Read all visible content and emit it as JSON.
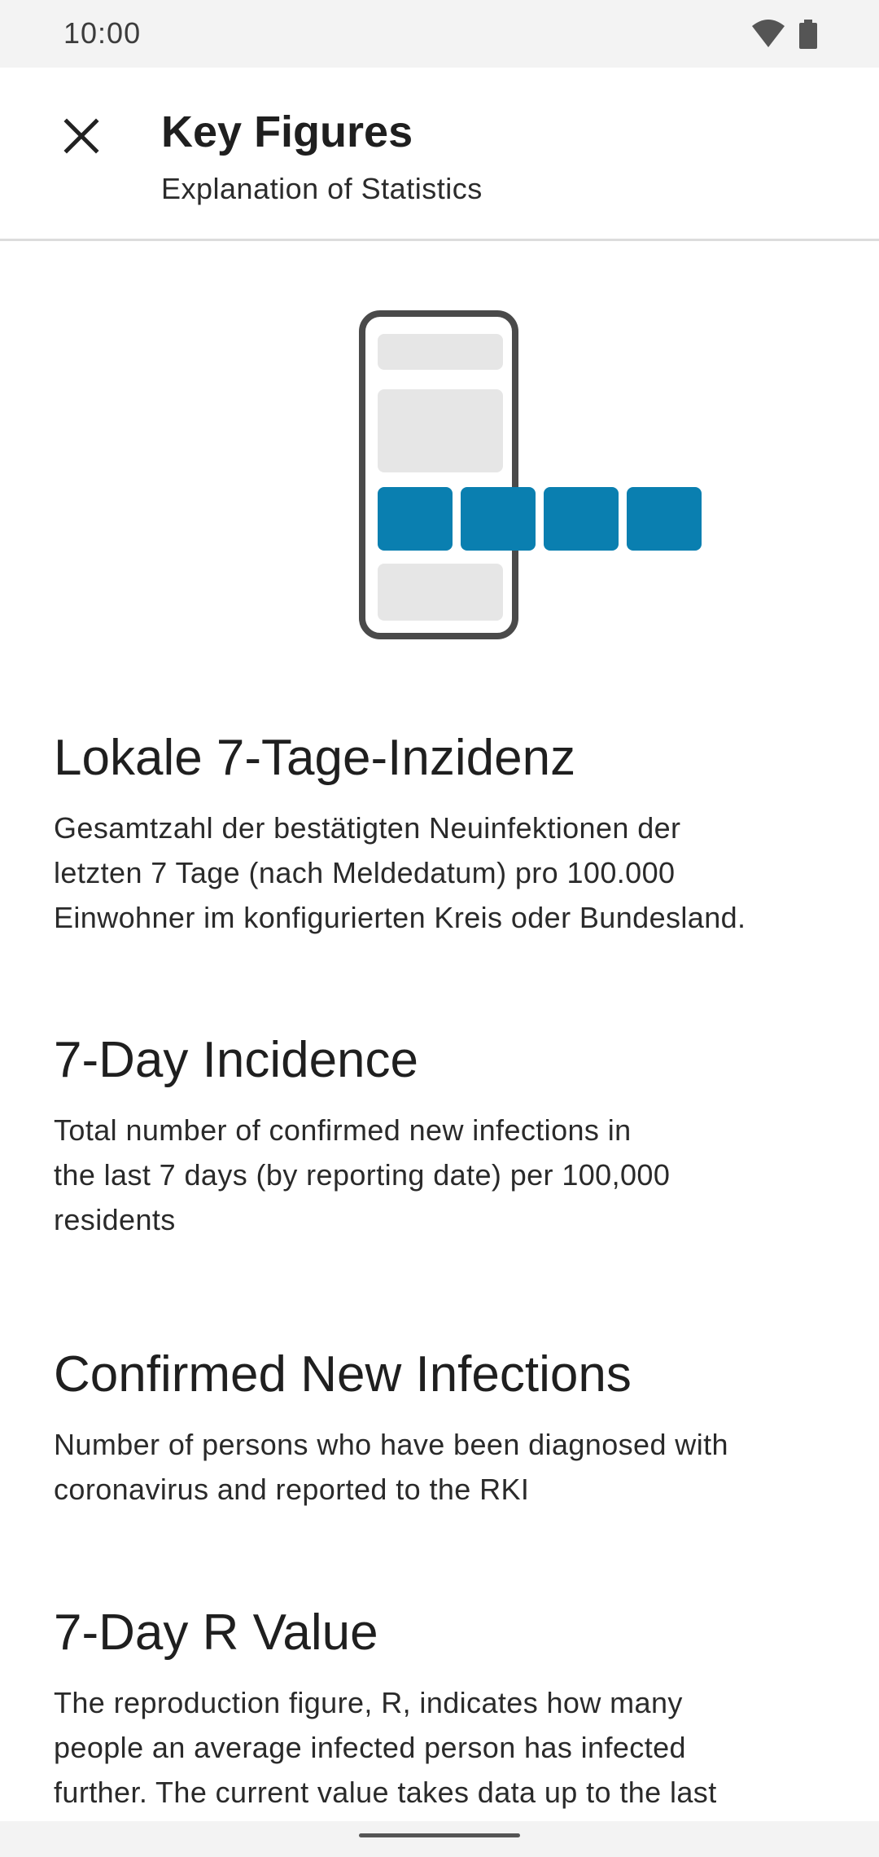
{
  "status_bar": {
    "time": "10:00",
    "icons": [
      "wifi-icon",
      "battery-icon"
    ]
  },
  "app_bar": {
    "close_icon": "close-icon",
    "title": "Key Figures",
    "subtitle": "Explanation of Statistics"
  },
  "illustration": {
    "icon": "phone-key-figures-illustration",
    "accent_color": "#0a7fb0",
    "frame_color": "#4a4a4a",
    "placeholder_color": "#e6e6e6"
  },
  "sections": [
    {
      "heading": "Lokale 7-Tage-Inzidenz",
      "lines": [
        "Gesamtzahl der bestätigten Neuinfektionen der",
        "letzten 7 Tage (nach Meldedatum) pro 100.000",
        "Einwohner im konfigurierten Kreis oder Bundesland."
      ]
    },
    {
      "heading": "7-Day Incidence",
      "lines": [
        "Total number of confirmed new infections in",
        "the last 7 days (by reporting date) per 100,000",
        "residents"
      ]
    },
    {
      "heading": "Confirmed New Infections",
      "lines": [
        "Number of persons who have been diagnosed with",
        "coronavirus and reported to the RKI"
      ]
    },
    {
      "heading": "7-Day R Value",
      "lines": [
        "The reproduction figure, R, indicates how many",
        "people an average infected person has infected",
        "further. The current value takes data up to the last"
      ]
    }
  ]
}
